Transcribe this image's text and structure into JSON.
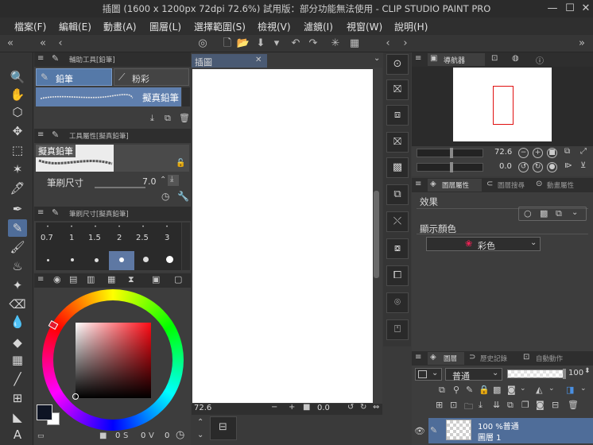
{
  "window": {
    "title": "插圖 (1600 x 1200px 72dpi 72.6%)  試用版：部分功能無法使用 - CLIP STUDIO PAINT PRO",
    "min": "—",
    "max": "☐",
    "close": "✕"
  },
  "menu": [
    "檔案(F)",
    "編輯(E)",
    "動畫(A)",
    "圖層(L)",
    "選擇範圍(S)",
    "檢視(V)",
    "濾鏡(I)",
    "視窗(W)",
    "說明(H)"
  ],
  "sub_tool_panel": {
    "title": "輔助工具[鉛筆]",
    "tabs": [
      "鉛筆",
      "粉彩"
    ],
    "selected_brush": "擬真鉛筆"
  },
  "tool_property": {
    "title": "工具屬性[擬真鉛筆]",
    "preview_label": "擬真鉛筆",
    "brush_size_label": "筆刷尺寸",
    "brush_size_value": "7.0"
  },
  "brush_size_panel": {
    "title": "筆刷尺寸[擬真鉛筆]",
    "sizes": [
      "0.7",
      "1",
      "1.5",
      "2",
      "2.5",
      "3"
    ],
    "selected_index": 9
  },
  "color": {
    "main": "#0e1424",
    "sub": "#ffffff",
    "bottom_values": [
      "0",
      "0",
      "0"
    ]
  },
  "canvas": {
    "tab_title": "插圖",
    "zoom": "72.6",
    "angle": "0.0"
  },
  "navigator": {
    "title": "導航器",
    "zoom": "72.6",
    "angle": "0.0"
  },
  "layer_property": {
    "tabs": [
      "圖層屬性",
      "圖層搜尋",
      "動畫屬性"
    ],
    "effect_label": "效果",
    "display_color_label": "顯示顏色",
    "display_color_value": "彩色"
  },
  "layer_panel": {
    "tabs": [
      "圖層",
      "歷史記錄",
      "自動動作"
    ],
    "blend_mode": "普通",
    "opacity": "100",
    "layer_opacity_text": "100 %普通",
    "layer_name": "圖層 1"
  }
}
